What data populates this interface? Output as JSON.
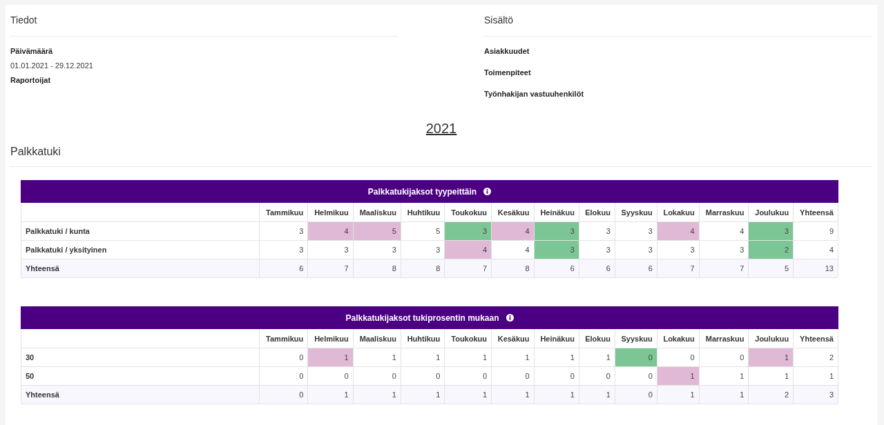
{
  "info": {
    "title": "Tiedot",
    "fields": [
      {
        "label": "Päivämäärä",
        "value": "01.01.2021 - 29.12.2021"
      },
      {
        "label": "Raportoijat"
      }
    ]
  },
  "content": {
    "title": "Sisältö",
    "items": [
      "Asiakkuudet",
      "Toimenpiteet",
      "Työnhakijan vastuuhenkilöt"
    ]
  },
  "year": "2021",
  "section_title": "Palkkatuki",
  "tables": [
    {
      "title": "Palkkatukijaksot tyypeittäin",
      "columns": [
        "Tammikuu",
        "Helmikuu",
        "Maaliskuu",
        "Huhtikuu",
        "Toukokuu",
        "Kesäkuu",
        "Heinäkuu",
        "Elokuu",
        "Syyskuu",
        "Lokakuu",
        "Marraskuu",
        "Joulukuu",
        "Yhteensä"
      ],
      "rows": [
        {
          "kind": "data",
          "label": "Palkkatuki / kunta",
          "cells": [
            {
              "value": "3"
            },
            {
              "value": "4",
              "color": "#e0b9d6"
            },
            {
              "value": "5",
              "color": "#e0b9d6"
            },
            {
              "value": "5"
            },
            {
              "value": "3",
              "color": "#7cc695"
            },
            {
              "value": "4",
              "color": "#e0b9d6"
            },
            {
              "value": "3",
              "color": "#7cc695"
            },
            {
              "value": "3"
            },
            {
              "value": "3"
            },
            {
              "value": "4",
              "color": "#e0b9d6"
            },
            {
              "value": "4"
            },
            {
              "value": "3",
              "color": "#7cc695"
            },
            {
              "value": "9"
            }
          ]
        },
        {
          "kind": "data",
          "label": "Palkkatuki / yksityinen",
          "cells": [
            {
              "value": "3"
            },
            {
              "value": "3"
            },
            {
              "value": "3"
            },
            {
              "value": "3"
            },
            {
              "value": "4",
              "color": "#e0b9d6"
            },
            {
              "value": "4"
            },
            {
              "value": "3",
              "color": "#7cc695"
            },
            {
              "value": "3"
            },
            {
              "value": "3"
            },
            {
              "value": "3"
            },
            {
              "value": "3"
            },
            {
              "value": "2",
              "color": "#7cc695"
            },
            {
              "value": "4"
            }
          ]
        },
        {
          "kind": "total",
          "label": "Yhteensä",
          "cells": [
            {
              "value": "6"
            },
            {
              "value": "7"
            },
            {
              "value": "8"
            },
            {
              "value": "8"
            },
            {
              "value": "7"
            },
            {
              "value": "8"
            },
            {
              "value": "6"
            },
            {
              "value": "6"
            },
            {
              "value": "6"
            },
            {
              "value": "7"
            },
            {
              "value": "7"
            },
            {
              "value": "5"
            },
            {
              "value": "13"
            }
          ]
        }
      ]
    },
    {
      "title": "Palkkatukijaksot tukiprosentin mukaan",
      "columns": [
        "Tammikuu",
        "Helmikuu",
        "Maaliskuu",
        "Huhtikuu",
        "Toukokuu",
        "Kesäkuu",
        "Heinäkuu",
        "Elokuu",
        "Syyskuu",
        "Lokakuu",
        "Marraskuu",
        "Joulukuu",
        "Yhteensä"
      ],
      "rows": [
        {
          "kind": "data",
          "label": "30",
          "cells": [
            {
              "value": "0"
            },
            {
              "value": "1",
              "color": "#e0b9d6"
            },
            {
              "value": "1"
            },
            {
              "value": "1"
            },
            {
              "value": "1"
            },
            {
              "value": "1"
            },
            {
              "value": "1"
            },
            {
              "value": "1"
            },
            {
              "value": "0",
              "color": "#7cc695"
            },
            {
              "value": "0"
            },
            {
              "value": "0"
            },
            {
              "value": "1",
              "color": "#e0b9d6"
            },
            {
              "value": "2"
            }
          ]
        },
        {
          "kind": "data",
          "label": "50",
          "cells": [
            {
              "value": "0"
            },
            {
              "value": "0"
            },
            {
              "value": "0"
            },
            {
              "value": "0"
            },
            {
              "value": "0"
            },
            {
              "value": "0"
            },
            {
              "value": "0"
            },
            {
              "value": "0"
            },
            {
              "value": "0"
            },
            {
              "value": "1",
              "color": "#e0b9d6"
            },
            {
              "value": "1"
            },
            {
              "value": "1"
            },
            {
              "value": "1"
            }
          ]
        },
        {
          "kind": "total",
          "label": "Yhteensä",
          "cells": [
            {
              "value": "0"
            },
            {
              "value": "1"
            },
            {
              "value": "1"
            },
            {
              "value": "1"
            },
            {
              "value": "1"
            },
            {
              "value": "1"
            },
            {
              "value": "1"
            },
            {
              "value": "1"
            },
            {
              "value": "0"
            },
            {
              "value": "1"
            },
            {
              "value": "1"
            },
            {
              "value": "2"
            },
            {
              "value": "3"
            }
          ]
        }
      ]
    }
  ]
}
